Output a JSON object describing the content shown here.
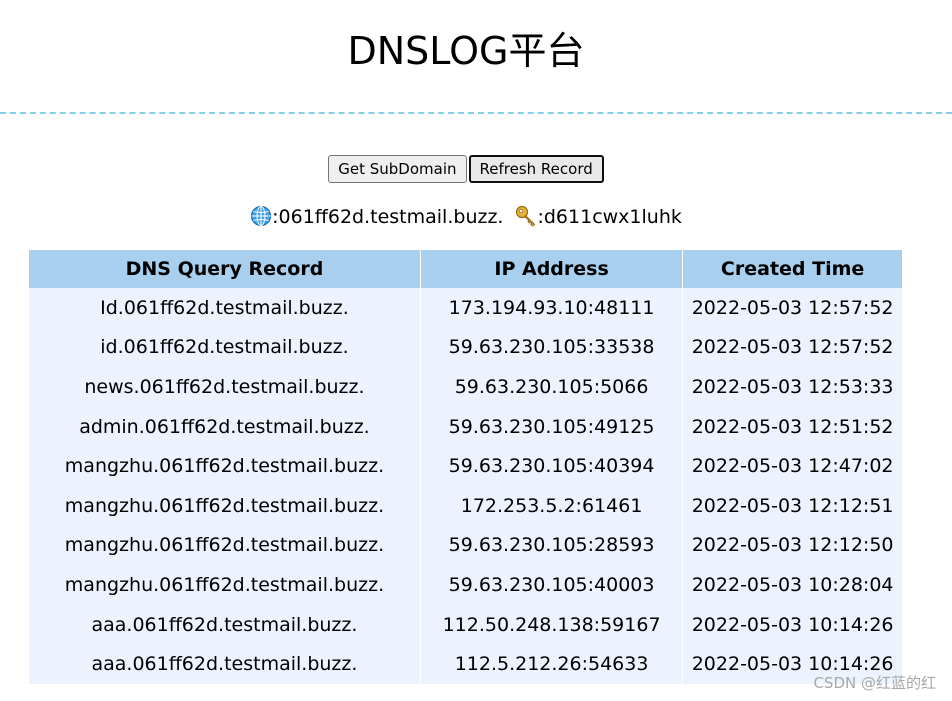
{
  "page": {
    "title": "DNSLOG平台"
  },
  "toolbar": {
    "get_subdomain_label": "Get SubDomain",
    "refresh_record_label": "Refresh Record"
  },
  "info": {
    "domain_icon": "globe-icon",
    "domain_text": ":061ff62d.testmail.buzz.",
    "token_icon": "key-icon",
    "token_text": ":d611cwx1luhk"
  },
  "table": {
    "headers": [
      "DNS Query Record",
      "IP Address",
      "Created Time"
    ],
    "rows": [
      [
        "Id.061ff62d.testmail.buzz.",
        "173.194.93.10:48111",
        "2022-05-03 12:57:52"
      ],
      [
        "id.061ff62d.testmail.buzz.",
        "59.63.230.105:33538",
        "2022-05-03 12:57:52"
      ],
      [
        "news.061ff62d.testmail.buzz.",
        "59.63.230.105:5066",
        "2022-05-03 12:53:33"
      ],
      [
        "admin.061ff62d.testmail.buzz.",
        "59.63.230.105:49125",
        "2022-05-03 12:51:52"
      ],
      [
        "mangzhu.061ff62d.testmail.buzz.",
        "59.63.230.105:40394",
        "2022-05-03 12:47:02"
      ],
      [
        "mangzhu.061ff62d.testmail.buzz.",
        "172.253.5.2:61461",
        "2022-05-03 12:12:51"
      ],
      [
        "mangzhu.061ff62d.testmail.buzz.",
        "59.63.230.105:28593",
        "2022-05-03 12:12:50"
      ],
      [
        "mangzhu.061ff62d.testmail.buzz.",
        "59.63.230.105:40003",
        "2022-05-03 10:28:04"
      ],
      [
        "aaa.061ff62d.testmail.buzz.",
        "112.50.248.138:59167",
        "2022-05-03 10:14:26"
      ],
      [
        "aaa.061ff62d.testmail.buzz.",
        "112.5.212.26:54633",
        "2022-05-03 10:14:26"
      ]
    ]
  },
  "watermark": {
    "text": "CSDN @红蓝的红"
  },
  "colors": {
    "header_bg": "#a8d0ee",
    "row_bg": "#ecf2fe",
    "divider": "#87ceeb"
  }
}
